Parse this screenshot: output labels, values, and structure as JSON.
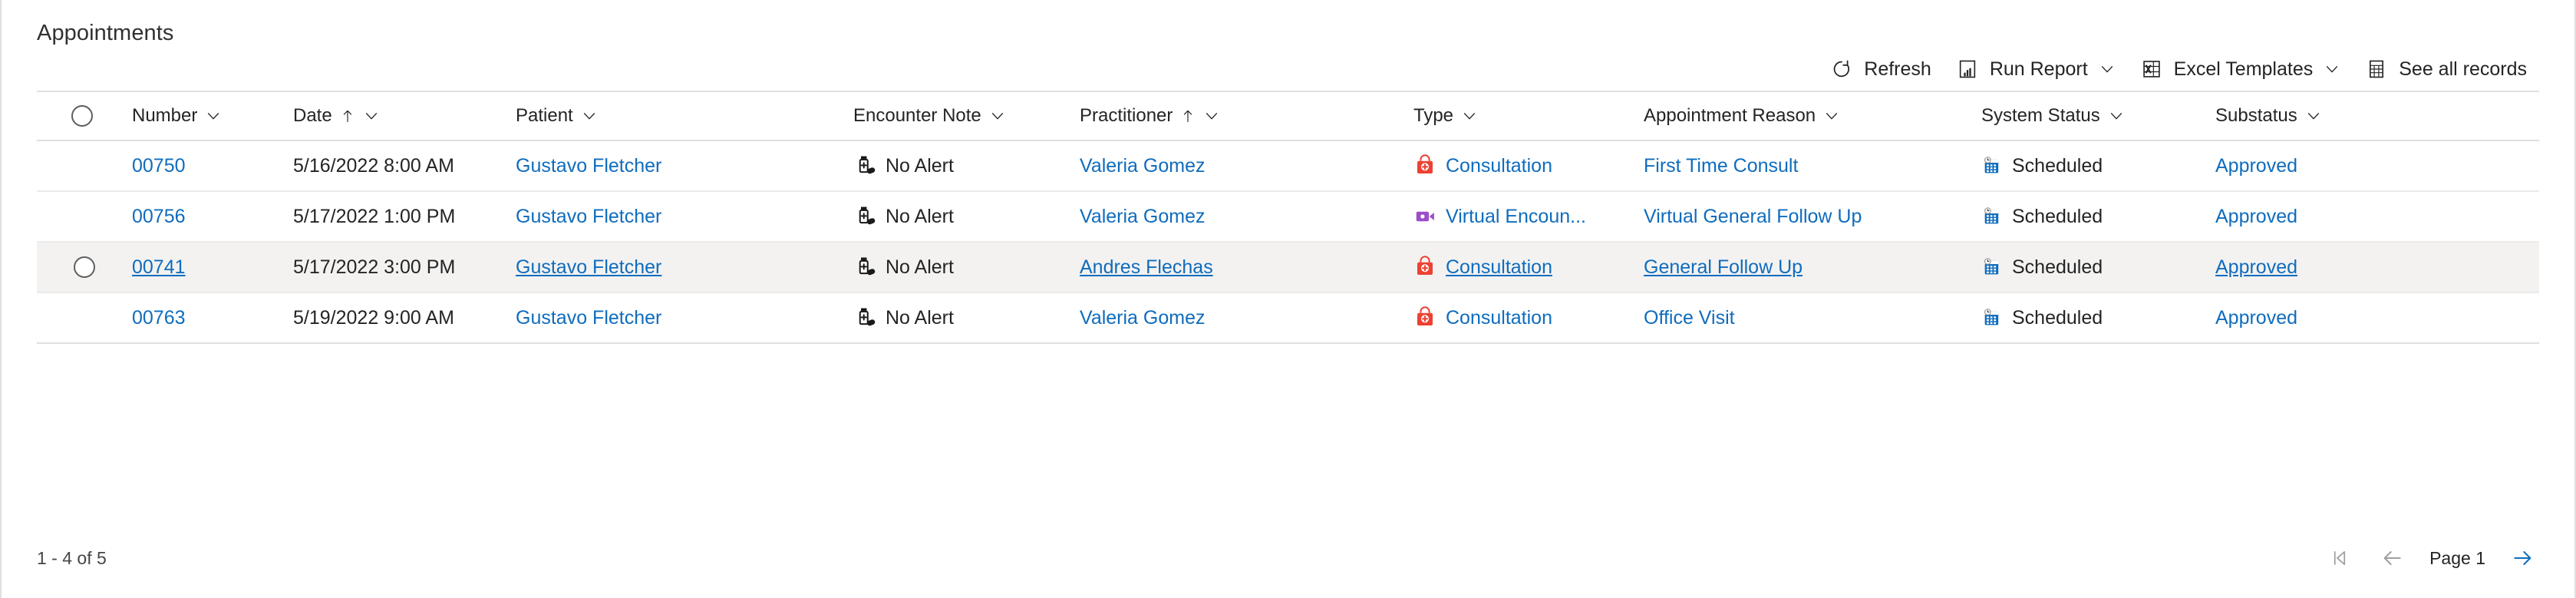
{
  "panel": {
    "title": "Appointments"
  },
  "commands": [
    {
      "label": "Refresh",
      "icon": "refresh-icon",
      "caret": false
    },
    {
      "label": "Run Report",
      "icon": "report-icon",
      "caret": true
    },
    {
      "label": "Excel Templates",
      "icon": "excel-icon",
      "caret": true
    },
    {
      "label": "See all records",
      "icon": "see-all-records-icon",
      "caret": false
    }
  ],
  "columns": [
    {
      "key": "number",
      "label": "Number",
      "sort": "",
      "caret": true
    },
    {
      "key": "date",
      "label": "Date",
      "sort": "asc",
      "caret": true
    },
    {
      "key": "patient",
      "label": "Patient",
      "sort": "",
      "caret": true
    },
    {
      "key": "note",
      "label": "Encounter Note",
      "sort": "",
      "caret": true
    },
    {
      "key": "pract",
      "label": "Practitioner",
      "sort": "asc",
      "caret": true
    },
    {
      "key": "type",
      "label": "Type",
      "sort": "",
      "caret": true
    },
    {
      "key": "reason",
      "label": "Appointment Reason",
      "sort": "",
      "caret": true
    },
    {
      "key": "status",
      "label": "System Status",
      "sort": "",
      "caret": true
    },
    {
      "key": "substatus",
      "label": "Substatus",
      "sort": "",
      "caret": true
    }
  ],
  "rows": [
    {
      "selected": false,
      "number": "00750",
      "date": "5/16/2022 8:00 AM",
      "patient": "Gustavo Fletcher",
      "note": "No Alert",
      "note_icon": "medicine-bottle-icon",
      "practitioner": "Valeria Gomez",
      "type": "Consultation",
      "type_icon": "medical-bag-icon",
      "reason": "First Time Consult",
      "status": "Scheduled",
      "status_icon": "calendar-clock-icon",
      "substatus": "Approved"
    },
    {
      "selected": false,
      "number": "00756",
      "date": "5/17/2022 1:00 PM",
      "patient": "Gustavo Fletcher",
      "note": "No Alert",
      "note_icon": "medicine-bottle-icon",
      "practitioner": "Valeria Gomez",
      "type": "Virtual Encoun...",
      "type_icon": "video-camera-icon",
      "reason": "Virtual General Follow Up",
      "status": "Scheduled",
      "status_icon": "calendar-clock-icon",
      "substatus": "Approved"
    },
    {
      "selected": true,
      "number": "00741",
      "date": "5/17/2022 3:00 PM",
      "patient": "Gustavo Fletcher",
      "note": "No Alert",
      "note_icon": "medicine-bottle-icon",
      "practitioner": "Andres Flechas",
      "type": "Consultation",
      "type_icon": "medical-bag-icon",
      "reason": "General Follow Up",
      "status": "Scheduled",
      "status_icon": "calendar-clock-icon",
      "substatus": "Approved"
    },
    {
      "selected": false,
      "number": "00763",
      "date": "5/19/2022 9:00 AM",
      "patient": "Gustavo Fletcher",
      "note": "No Alert",
      "note_icon": "medicine-bottle-icon",
      "practitioner": "Valeria Gomez",
      "type": "Consultation",
      "type_icon": "medical-bag-icon",
      "reason": "Office Visit",
      "status": "Scheduled",
      "status_icon": "calendar-clock-icon",
      "substatus": "Approved"
    }
  ],
  "footer": {
    "record_count": "1 - 4 of 5",
    "page_label": "Page 1",
    "first_page_enabled": false,
    "prev_page_enabled": false,
    "next_page_enabled": true
  },
  "colors": {
    "link": "#0f6cbd",
    "consultation": "#ec4234",
    "virtual": "#9b4dca",
    "status": "#0f6cbd",
    "selected_row": "#f3f2f1"
  }
}
